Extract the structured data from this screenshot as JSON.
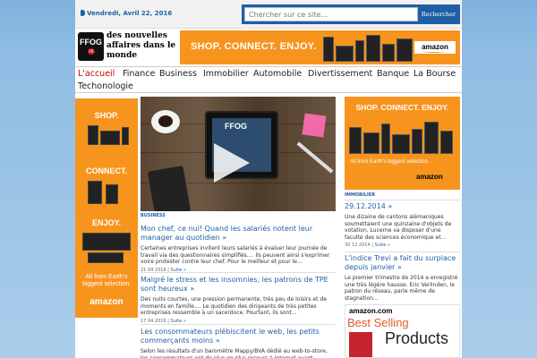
{
  "topbar": {
    "date": "Vendredi, Avril 22, 2016",
    "search_placeholder": "Chercher sur ce site...",
    "search_button": "Rechercher"
  },
  "logo": {
    "text": "FFOG",
    "badge": "FR"
  },
  "tagline": "des nouvelles affaires dans le monde",
  "banner_top": {
    "text": "SHOP.   CONNECT.   ENJOY.",
    "brand": "amazon"
  },
  "nav": {
    "items": [
      "L'accueil",
      "Finance",
      "Business",
      "Immobilier",
      "Automobile",
      "Divertissement",
      "Banque",
      "La Bourse",
      "Techonologie"
    ]
  },
  "ad_left": {
    "shop": "SHOP.",
    "connect": "CONNECT.",
    "enjoy": "ENJOY.",
    "small": "All from Earth's biggest selection.",
    "brand": "amazon"
  },
  "hero": {
    "logo": "FFOG",
    "sub": "VIDEO"
  },
  "main": {
    "category": "BUSINESS",
    "articles": [
      {
        "title": "Mon chef, ce nul! Quand les salariés notent leur manager au quotidien »",
        "excerpt": "Certaines entreprises invitent leurs salariés à évaluer leur journée de travail via des questionnaires simplifiés.... Ils peuvent ainsi s'exprimer voire protester contre leur chef. Pour le meilleur et pour le...",
        "date": "21 04 2016",
        "more": "Suite »"
      },
      {
        "title": "Malgré le stress et les insomnies, les patrons de TPE sont heureux »",
        "excerpt": "Des nuits courtes, une pression permanente, très peu de loisirs et de moments en famille.... Le quotidien des dirigeants de très petites entreprises ressemble à un sacerdoce. Pourtant, ils sont...",
        "date": "17 04 2016",
        "more": "Suite »"
      },
      {
        "title": "Les consommateurs plébiscitent le web, les petits commerçants moins »",
        "excerpt": "Selon les résultats d'un baromètre Mappy/BVA dédié au web-to-store, les consommateurs ont de plus en plus recours à Internet avant, pendant mais",
        "date": "",
        "more": ""
      }
    ]
  },
  "ad_right": {
    "text": "SHOP. CONNECT. ENJOY.",
    "small": "All from Earth's biggest selection.",
    "brand": "amazon"
  },
  "side": {
    "category": "IMMOBILIER",
    "articles": [
      {
        "title": "29.12.2014 »",
        "excerpt": "Une dizaine de cantons alémaniques soumettaient une quinzaine d'objets de votation. Lucerne va disposer d'une faculté des sciences économique et...",
        "date": "30 12 2014",
        "more": "Suite »"
      },
      {
        "title": "L'indice Trevi a fait du surplace depuis janvier »",
        "excerpt": "Le premier trimestre de 2014 a enregistré une très légère hausse. Eric Verlinden, le patron du réseau, parle même de stagnation...",
        "date": "12 04 2014",
        "more": "Suite »"
      }
    ]
  },
  "bestsell": {
    "brand": "amazon.com",
    "line1": "Best Selling",
    "line2": "Products"
  },
  "colors": {
    "accent": "#1f5fa8",
    "amazon_orange": "#f7941d",
    "nav_active": "#cc0000"
  }
}
